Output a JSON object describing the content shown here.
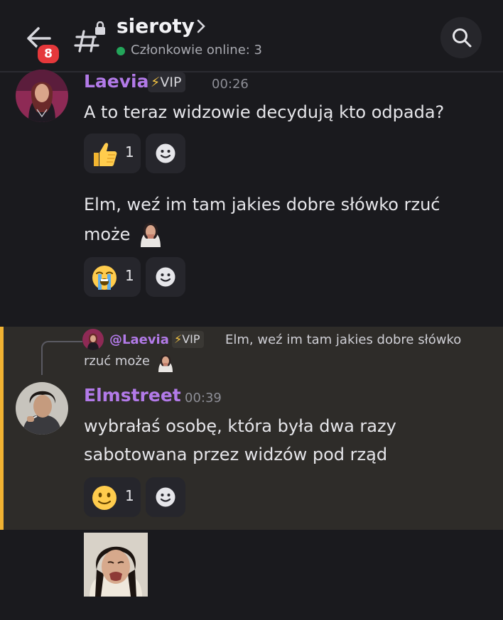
{
  "header": {
    "unread_count": "8",
    "channel_name": "sieroty",
    "online_text": "Członkowie online: 3",
    "online_color": "#23a55a"
  },
  "messages": [
    {
      "author": "Laevia",
      "role_tag": "VIP",
      "time": "00:26",
      "lines": [
        "A to teraz widzowie decydują kto odpada?"
      ],
      "reaction": {
        "emoji": "thumbs-up",
        "count": "1"
      }
    },
    {
      "lines": [
        "Elm, weź im tam jakies dobre słówko rzuć",
        "może"
      ],
      "reaction": {
        "emoji": "loudly-crying-face",
        "count": "1"
      }
    },
    {
      "reply_to": {
        "author": "@Laevia",
        "role_tag": "VIP",
        "text_line1": "Elm, weź im tam jakies dobre słówko",
        "text_line2": "rzuć może"
      },
      "author": "Elmstreet",
      "time": "00:39",
      "lines": [
        "wybrałaś osobę, która była dwa razy",
        "sabotowana przez widzów pod rząd"
      ],
      "reaction": {
        "emoji": "slightly-smiling-face",
        "count": "1"
      }
    }
  ],
  "colors": {
    "username": "#b27ae8",
    "highlight_border": "#f0b232",
    "badge": "#e5383b"
  }
}
